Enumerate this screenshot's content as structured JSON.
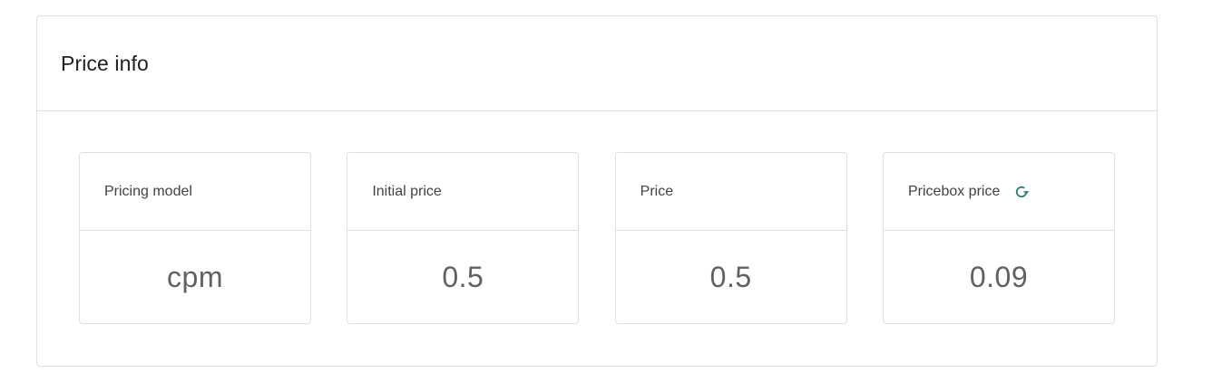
{
  "panel": {
    "title": "Price info"
  },
  "cards": [
    {
      "label": "Pricing model",
      "value": "cpm"
    },
    {
      "label": "Initial price",
      "value": "0.5"
    },
    {
      "label": "Price",
      "value": "0.5"
    },
    {
      "label": "Pricebox price",
      "value": "0.09",
      "icon": "refresh-icon"
    }
  ],
  "colors": {
    "accent": "#26806b",
    "border": "#e0e0e0",
    "title_text": "#212121",
    "value_text": "#616161"
  }
}
